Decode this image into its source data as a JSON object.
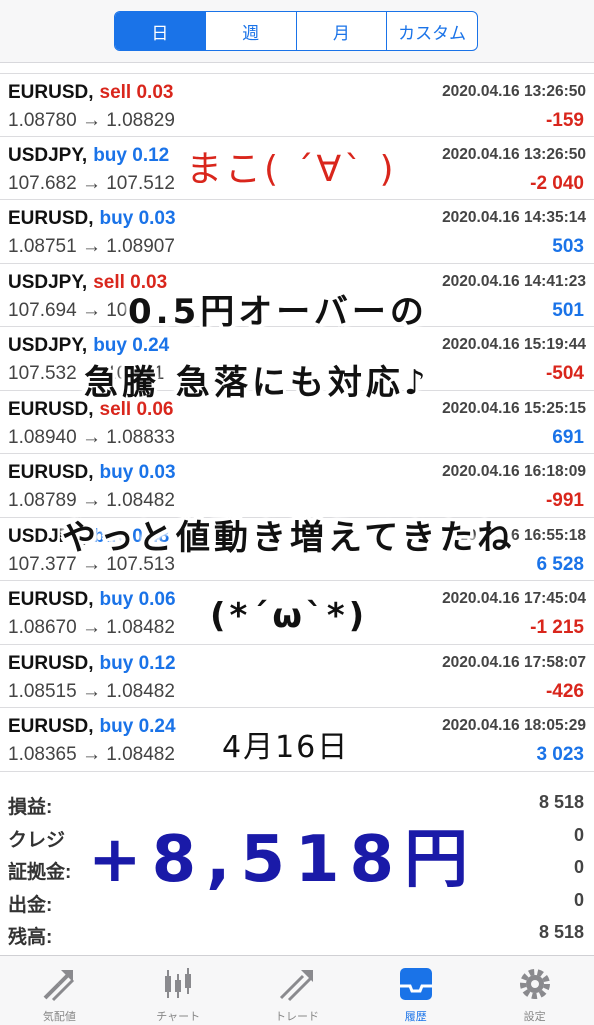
{
  "tabs": [
    {
      "label": "日",
      "active": true
    },
    {
      "label": "週",
      "active": false
    },
    {
      "label": "月",
      "active": false
    },
    {
      "label": "カスタム",
      "active": false
    }
  ],
  "trades": [
    {
      "symbol": "EURUSD,",
      "side": "sell 0.03",
      "side_type": "sell",
      "datetime": "2020.04.16 13:26:50",
      "price": "1.08780 → 1.08829",
      "profit": "-159",
      "profit_type": "neg"
    },
    {
      "symbol": "USDJPY,",
      "side": "buy 0.12",
      "side_type": "buy",
      "datetime": "2020.04.16 13:26:50",
      "price": "107.682 → 107.512",
      "profit": "-2 040",
      "profit_type": "neg"
    },
    {
      "symbol": "EURUSD,",
      "side": "buy 0.03",
      "side_type": "buy",
      "datetime": "2020.04.16 14:35:14",
      "price": "1.08751 → 1.08907",
      "profit": "503",
      "profit_type": "pos"
    },
    {
      "symbol": "USDJPY,",
      "side": "sell 0.03",
      "side_type": "sell",
      "datetime": "2020.04.16 14:41:23",
      "price": "107.694 → 107.5",
      "profit": "501",
      "profit_type": "pos"
    },
    {
      "symbol": "USDJPY,",
      "side": "buy 0.24",
      "side_type": "buy",
      "datetime": "2020.04.16 15:19:44",
      "price": "107.532 → 107.51",
      "profit": "-504",
      "profit_type": "neg"
    },
    {
      "symbol": "EURUSD,",
      "side": "sell 0.06",
      "side_type": "sell",
      "datetime": "2020.04.16 15:25:15",
      "price": "1.08940 → 1.08833",
      "profit": "691",
      "profit_type": "pos"
    },
    {
      "symbol": "EURUSD,",
      "side": "buy 0.03",
      "side_type": "buy",
      "datetime": "2020.04.16 16:18:09",
      "price": "1.08789 → 1.08482",
      "profit": "-991",
      "profit_type": "neg"
    },
    {
      "symbol": "USDJPY,",
      "side": "buy 0.48",
      "side_type": "buy",
      "datetime": "2020.04.16 16:55:18",
      "price": "107.377 → 107.513",
      "profit": "6 528",
      "profit_type": "pos"
    },
    {
      "symbol": "EURUSD,",
      "side": "buy 0.06",
      "side_type": "buy",
      "datetime": "2020.04.16 17:45:04",
      "price": "1.08670 → 1.08482",
      "profit": "-1 215",
      "profit_type": "neg"
    },
    {
      "symbol": "EURUSD,",
      "side": "buy 0.12",
      "side_type": "buy",
      "datetime": "2020.04.16 17:58:07",
      "price": "1.08515 → 1.08482",
      "profit": "-426",
      "profit_type": "neg"
    },
    {
      "symbol": "EURUSD,",
      "side": "buy 0.24",
      "side_type": "buy",
      "datetime": "2020.04.16 18:05:29",
      "price": "1.08365 → 1.08482",
      "profit": "3 023",
      "profit_type": "pos"
    }
  ],
  "summary": [
    {
      "label": "損益:",
      "value": "8 518"
    },
    {
      "label": "クレジ",
      "value": "0"
    },
    {
      "label": "証拠金:",
      "value": "0"
    },
    {
      "label": "出金:",
      "value": "0"
    },
    {
      "label": "残高:",
      "value": "8 518"
    }
  ],
  "nav": [
    {
      "label": "気配値",
      "icon": "quotes-icon",
      "active": false
    },
    {
      "label": "チャート",
      "icon": "chart-icon",
      "active": false
    },
    {
      "label": "トレード",
      "icon": "trade-icon",
      "active": false
    },
    {
      "label": "履歴",
      "icon": "history-icon",
      "active": true
    },
    {
      "label": "設定",
      "icon": "settings-icon",
      "active": false
    }
  ],
  "annotations": {
    "red_note": "まこ( ´∀` )",
    "line1": "0.5円オーバーの",
    "line2": "急騰 急落にも対応♪",
    "line3": "やっと値動き増えてきたね",
    "line4": "(*´ω`*)",
    "date_note": "4月16日",
    "total_note": "+8,518円"
  },
  "colors": {
    "accent": "#1a73e8",
    "loss": "#d9261c",
    "handwriting_blue": "#1a1aa8"
  }
}
